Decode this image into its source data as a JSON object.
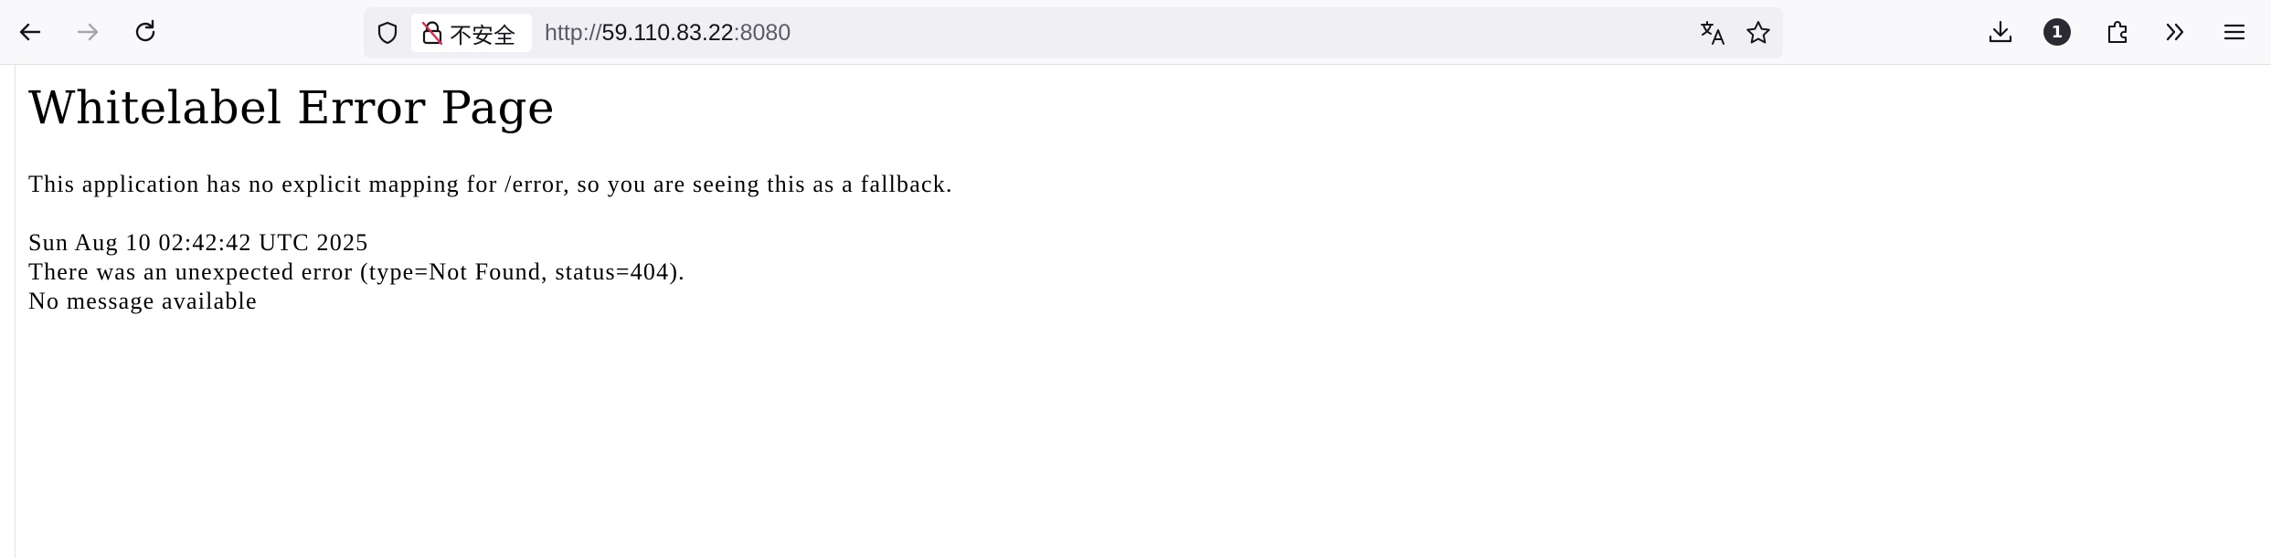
{
  "browser": {
    "identity_label": "不安全",
    "url_scheme": "http://",
    "url_host": "59.110.83.22",
    "url_port": ":8080",
    "extension_badge": "1",
    "icons": {
      "back": "back-arrow-icon",
      "forward": "forward-arrow-icon",
      "reload": "reload-icon",
      "tracking_protection": "shield-icon",
      "insecure": "insecure-lock-icon",
      "translate": "translate-icon",
      "bookmark": "star-icon",
      "downloads": "download-icon",
      "extensions": "puzzle-icon",
      "overflow": "double-chevron-icon",
      "menu": "hamburger-menu-icon"
    }
  },
  "page": {
    "heading": "Whitelabel Error Page",
    "explanation": "This application has no explicit mapping for /error, so you are seeing this as a fallback.",
    "timestamp": "Sun Aug 10 02:42:42 UTC 2025",
    "error_line": "There was an unexpected error (type=Not Found, status=404).",
    "message": "No message available"
  }
}
